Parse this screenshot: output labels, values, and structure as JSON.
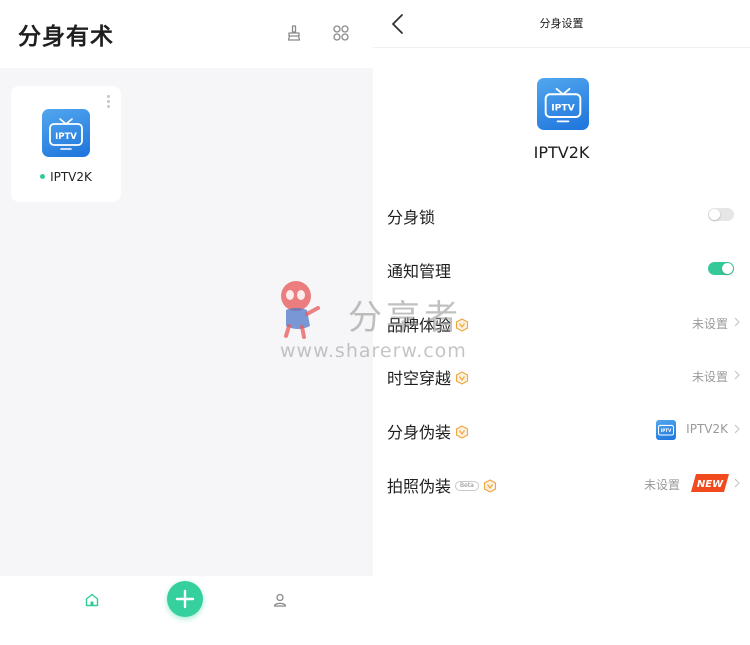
{
  "left_screen": {
    "app_title": "分身有术",
    "header_icons": [
      "clean-icon",
      "apps-grid-icon"
    ],
    "app_card": {
      "name": "IPTV2K",
      "icon_text": "IPTV",
      "status_color": "#35c99a"
    },
    "bottom_nav": {
      "items": [
        "home-icon",
        "add-icon",
        "profile-icon"
      ],
      "fab_color": "#35d09e"
    }
  },
  "right_screen": {
    "page_title": "分身设置",
    "app_icon_text": "IPTV",
    "app_name": "IPTV2K",
    "settings": [
      {
        "label": "分身锁",
        "type": "toggle",
        "on": false
      },
      {
        "label": "通知管理",
        "type": "toggle",
        "on": true
      },
      {
        "label": "品牌体验",
        "vip": true,
        "value": "未设置"
      },
      {
        "label": "时空穿越",
        "vip": true,
        "value": "未设置"
      },
      {
        "label": "分身伪装",
        "vip": true,
        "value": "IPTV2K",
        "value_icon_text": "IPTV"
      },
      {
        "label": "拍照伪装",
        "vip": true,
        "tag": "Beta",
        "value": "未设置",
        "badge": "NEW"
      }
    ]
  },
  "watermark": {
    "brand": "分享者",
    "url": "www.sharerw.com"
  },
  "colors": {
    "accent": "#35c99a",
    "vip": "#f0a640",
    "icon_gradient_top": "#52a7ee",
    "icon_gradient_bottom": "#1d74dc",
    "new_badge": "#f04a1e"
  }
}
